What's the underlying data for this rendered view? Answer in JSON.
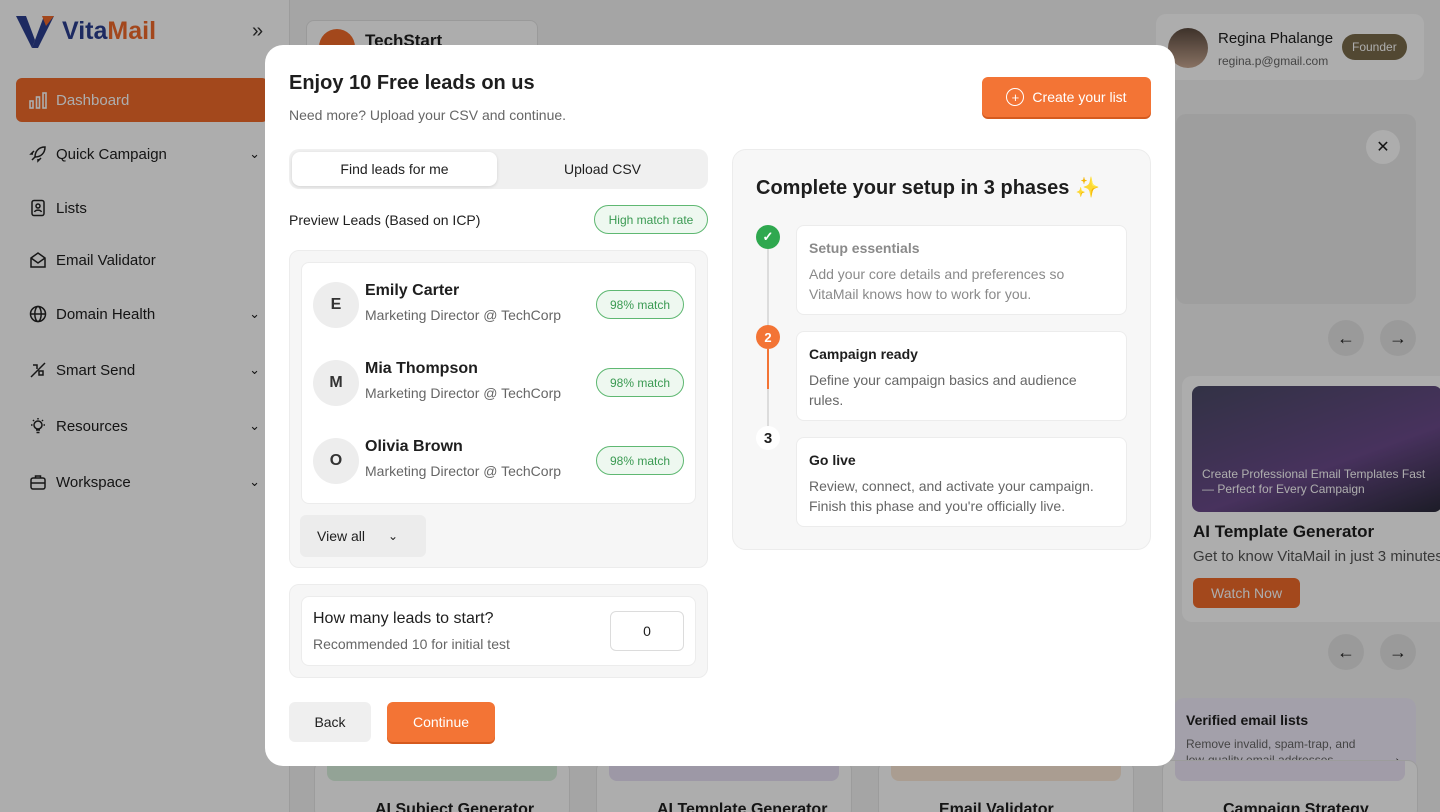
{
  "app": {
    "name_part1": "Vita",
    "name_part2": "Mail",
    "brand_colors": {
      "primary": "#2b3f8f",
      "accent": "#f0692a"
    }
  },
  "sidebar": {
    "collapse_icon": "double-chevron-right-icon",
    "items": [
      {
        "label": "Dashboard",
        "icon": "bar-chart-icon",
        "active": true,
        "expandable": false
      },
      {
        "label": "Quick Campaign",
        "icon": "rocket-icon",
        "expandable": true
      },
      {
        "label": "Lists",
        "icon": "contact-list-icon",
        "expandable": false
      },
      {
        "label": "Email Validator",
        "icon": "mail-check-icon",
        "expandable": false
      },
      {
        "label": "Domain Health",
        "icon": "globe-icon",
        "expandable": true
      },
      {
        "label": "Smart Send",
        "icon": "smart-send-icon",
        "expandable": true
      },
      {
        "label": "Resources",
        "icon": "lightbulb-icon",
        "expandable": true
      },
      {
        "label": "Workspace",
        "icon": "briefcase-icon",
        "expandable": true
      }
    ]
  },
  "header": {
    "workspace_name": "TechStart",
    "user": {
      "name": "Regina Phalange",
      "email": "regina.p@gmail.com",
      "role": "Founder"
    }
  },
  "background": {
    "promo": {
      "image_text": "Create Professional Email Templates Fast — Perfect for Every Campaign",
      "title": "AI Template Generator",
      "subtitle": "Get to know VitaMail in just 3 minutes",
      "button": "Watch Now"
    },
    "verified": {
      "title": "Verified email lists",
      "subtitle": "Remove invalid, spam-trap, and low-quality email addresses"
    },
    "tools": [
      "AI Subject Generator",
      "AI Template Generator",
      "Email Validator",
      "Campaign Strategy"
    ]
  },
  "modal": {
    "title": "Enjoy 10 Free leads on us",
    "subtitle": "Need more? Upload your CSV and continue.",
    "create_button": "Create your list",
    "tabs": [
      {
        "label": "Find leads for me",
        "selected": true
      },
      {
        "label": "Upload CSV",
        "selected": false
      }
    ],
    "preview_label": "Preview Leads (Based on ICP)",
    "match_badge": "High match rate",
    "leads": [
      {
        "initial": "E",
        "name": "Emily Carter",
        "role": "Marketing Director @ TechCorp",
        "match": "98% match"
      },
      {
        "initial": "M",
        "name": "Mia Thompson",
        "role": "Marketing Director @ TechCorp",
        "match": "98% match"
      },
      {
        "initial": "O",
        "name": "Olivia Brown",
        "role": "Marketing Director @ TechCorp",
        "match": "98% match"
      }
    ],
    "view_all": "View all",
    "lead_count": {
      "title": "How many leads to start?",
      "subtitle": "Recommended 10 for initial test",
      "value": "0"
    },
    "back_button": "Back",
    "continue_button": "Continue",
    "setup": {
      "title": "Complete your setup in 3 phases",
      "title_emoji": "✨",
      "steps": [
        {
          "marker": "✓",
          "state": "done",
          "title": "Setup essentials",
          "desc": "Add your core details and preferences so VitaMail knows how to work for you."
        },
        {
          "marker": "2",
          "state": "current",
          "title": "Campaign ready",
          "desc": "Define your campaign basics and audience rules."
        },
        {
          "marker": "3",
          "state": "todo",
          "title": "Go live",
          "desc": "Review, connect, and activate your campaign. Finish this phase and you're officially live."
        }
      ]
    }
  }
}
